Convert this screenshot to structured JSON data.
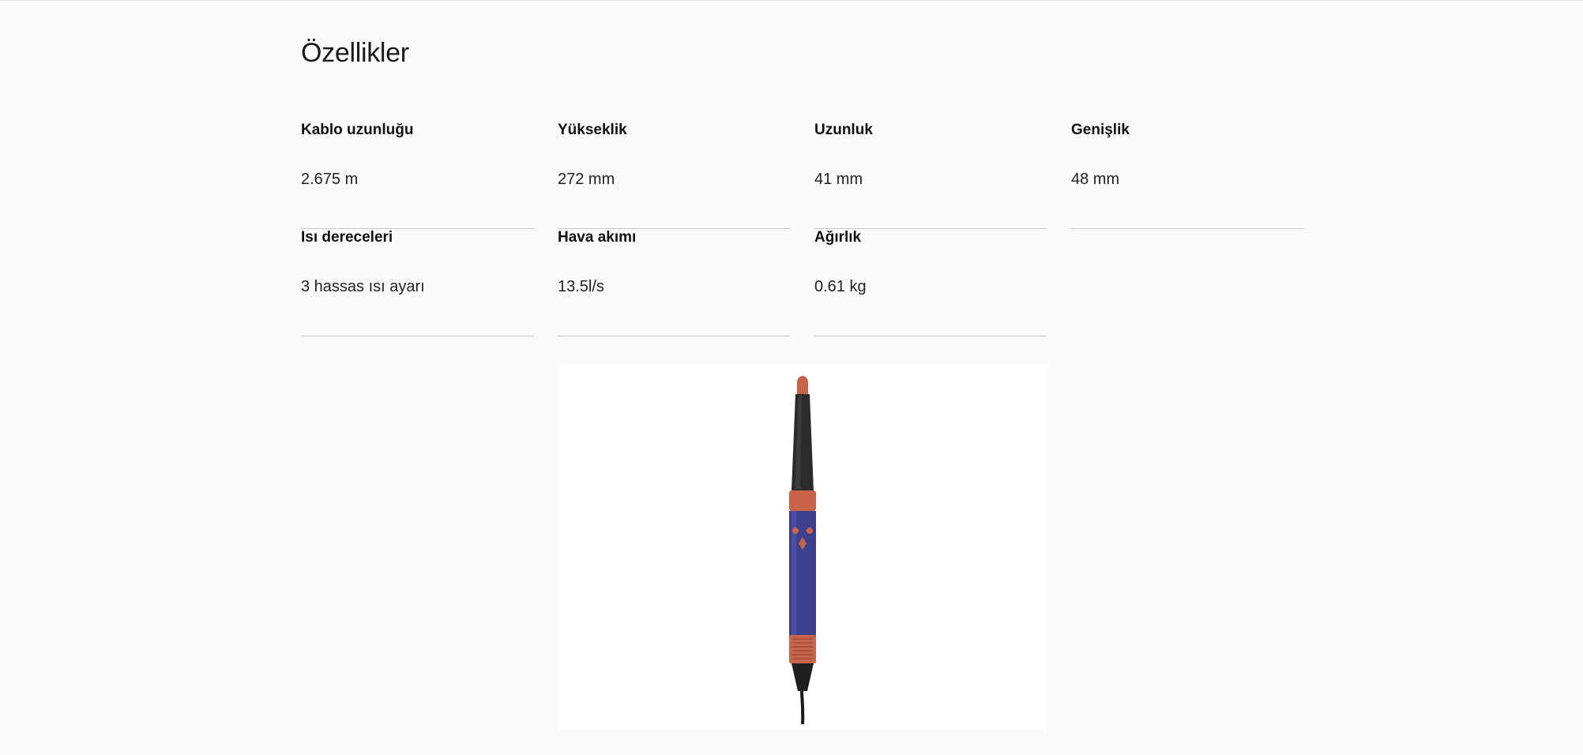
{
  "section": {
    "title": "Özellikler"
  },
  "specs": [
    {
      "label": "Kablo uzunluğu",
      "value": "2.675 m"
    },
    {
      "label": "Yükseklik",
      "value": "272 mm"
    },
    {
      "label": "Uzunluk",
      "value": "41 mm"
    },
    {
      "label": "Genişlik",
      "value": "48 mm"
    },
    {
      "label": "Isı dereceleri",
      "value": "3 hassas ısı ayarı"
    },
    {
      "label": "Hava akımı",
      "value": "13.5l/s"
    },
    {
      "label": "Ağırlık",
      "value": "0.61 kg"
    }
  ],
  "product_image": {
    "icon": "hair-styler-product-image",
    "colors": {
      "body": "#3b3f8c",
      "accent": "#c8644a",
      "barrel": "#2a2a2a"
    }
  }
}
